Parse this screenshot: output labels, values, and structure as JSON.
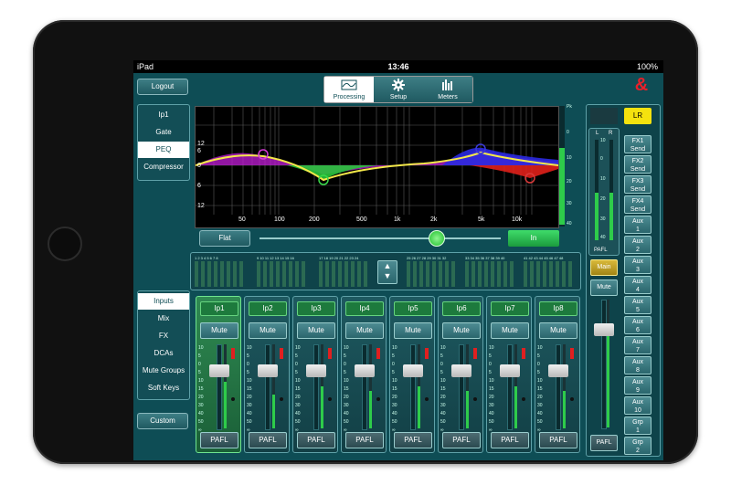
{
  "status_bar": {
    "device": "iPad",
    "time": "13:46",
    "battery": "100%"
  },
  "brand": {
    "logo_text": "&",
    "accent": "#e8202a"
  },
  "toolbar": {
    "logout_label": "Logout",
    "tabs": [
      {
        "label": "Processing",
        "icon": "eq-curve-icon",
        "active": true
      },
      {
        "label": "Setup",
        "icon": "gear-icon",
        "active": false
      },
      {
        "label": "Meters",
        "icon": "meter-bars-icon",
        "active": false
      }
    ]
  },
  "processing_menu": {
    "items": [
      {
        "label": "Ip1",
        "active": false
      },
      {
        "label": "Gate",
        "active": false
      },
      {
        "label": "PEQ",
        "active": true
      },
      {
        "label": "Compressor",
        "active": false
      }
    ]
  },
  "eq_graph": {
    "y_labels": [
      "12",
      "6",
      "0",
      "6",
      "12"
    ],
    "x_labels": [
      "50",
      "100",
      "200",
      "500",
      "1k",
      "2k",
      "5k",
      "10k"
    ],
    "meter_labels": [
      "Pk",
      "0",
      "10",
      "20",
      "30",
      "40"
    ],
    "flat_label": "Flat",
    "in_label": "In"
  },
  "meter_groups": [
    {
      "labels": "1 2 3 4 5 6 7 8"
    },
    {
      "labels": "9 10 11 12 13 14 15 16"
    },
    {
      "labels": "17 18 19 20 21 22 23 24"
    },
    {
      "labels": "25 26 27 28 29 30 31 32"
    },
    {
      "labels": "33 34 35 36 37 38 39 40"
    },
    {
      "labels": "41 42 43 44 45 46 47 48"
    }
  ],
  "layer_menu": {
    "items": [
      {
        "label": "Inputs",
        "active": true
      },
      {
        "label": "Mix",
        "active": false
      },
      {
        "label": "FX",
        "active": false
      },
      {
        "label": "DCAs",
        "active": false
      },
      {
        "label": "Mute Groups",
        "active": false
      },
      {
        "label": "Soft Keys",
        "active": false
      }
    ],
    "custom_label": "Custom"
  },
  "channels": [
    {
      "name": "Ip1",
      "mute": "Mute",
      "pafl": "PAFL",
      "selected": true,
      "meter": 0.55
    },
    {
      "name": "Ip2",
      "mute": "Mute",
      "pafl": "PAFL",
      "selected": false,
      "meter": 0.4
    },
    {
      "name": "Ip3",
      "mute": "Mute",
      "pafl": "PAFL",
      "selected": false,
      "meter": 0.5
    },
    {
      "name": "Ip4",
      "mute": "Mute",
      "pafl": "PAFL",
      "selected": false,
      "meter": 0.45
    },
    {
      "name": "Ip5",
      "mute": "Mute",
      "pafl": "PAFL",
      "selected": false,
      "meter": 0.5
    },
    {
      "name": "Ip6",
      "mute": "Mute",
      "pafl": "PAFL",
      "selected": false,
      "meter": 0.45
    },
    {
      "name": "Ip7",
      "mute": "Mute",
      "pafl": "PAFL",
      "selected": false,
      "meter": 0.5
    },
    {
      "name": "Ip8",
      "mute": "Mute",
      "pafl": "PAFL",
      "selected": false,
      "meter": 0.45
    }
  ],
  "fader_scale": [
    "10",
    "5",
    "0",
    "5",
    "10",
    "15",
    "20",
    "30",
    "40",
    "50",
    "∞"
  ],
  "master": {
    "lr_label": "LR",
    "lr_meter_labels": [
      "L",
      "R"
    ],
    "lr_scale": [
      "10",
      "0",
      "10",
      "20",
      "30",
      "40"
    ],
    "pafl_label": "PAFL",
    "main_label": "Main",
    "mute_label": "Mute",
    "main_pafl": "PAFL"
  },
  "sends": [
    {
      "line1": "FX1",
      "line2": "Send"
    },
    {
      "line1": "FX2",
      "line2": "Send"
    },
    {
      "line1": "FX3",
      "line2": "Send"
    },
    {
      "line1": "FX4",
      "line2": "Send"
    },
    {
      "line1": "Aux",
      "line2": "1"
    },
    {
      "line1": "Aux",
      "line2": "2"
    },
    {
      "line1": "Aux",
      "line2": "3"
    },
    {
      "line1": "Aux",
      "line2": "4"
    },
    {
      "line1": "Aux",
      "line2": "5"
    },
    {
      "line1": "Aux",
      "line2": "6"
    },
    {
      "line1": "Aux",
      "line2": "7"
    },
    {
      "line1": "Aux",
      "line2": "8"
    },
    {
      "line1": "Aux",
      "line2": "9"
    },
    {
      "line1": "Aux",
      "line2": "10"
    },
    {
      "line1": "Grp",
      "line2": "1"
    },
    {
      "line1": "Grp",
      "line2": "2"
    }
  ]
}
